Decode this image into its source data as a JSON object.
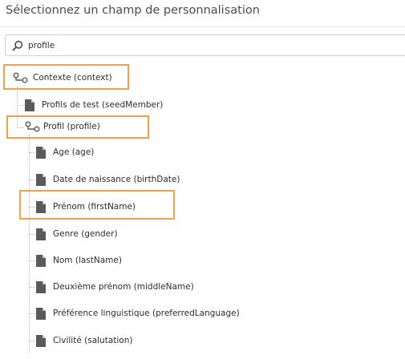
{
  "dialog": {
    "title": "Sélectionnez un champ de personnalisation"
  },
  "search": {
    "value": "profile",
    "icon": "search-icon"
  },
  "tree": {
    "root": {
      "label": "Contexte (context)",
      "icon": "link-node-icon"
    },
    "seed": {
      "label": "Profils de test (seedMember)",
      "icon": "file-icon"
    },
    "profile": {
      "label": "Profil (profile)",
      "icon": "link-node-icon",
      "children": [
        {
          "label": "Age (age)",
          "icon": "file-icon"
        },
        {
          "label": "Date de naissance (birthDate)",
          "icon": "file-icon"
        },
        {
          "label": "Prénom (firstName)",
          "icon": "file-icon"
        },
        {
          "label": "Genre (gender)",
          "icon": "file-icon"
        },
        {
          "label": "Nom (lastName)",
          "icon": "file-icon"
        },
        {
          "label": "Deuxième prénom (middleName)",
          "icon": "file-icon"
        },
        {
          "label": "Préférence linguistique (preferredLanguage)",
          "icon": "file-icon"
        },
        {
          "label": "Civilité (salutation)",
          "icon": "file-icon"
        }
      ]
    }
  },
  "colors": {
    "highlight": "#f0a24a",
    "icon": "#5a5a5a",
    "text": "#2c2c2c"
  }
}
